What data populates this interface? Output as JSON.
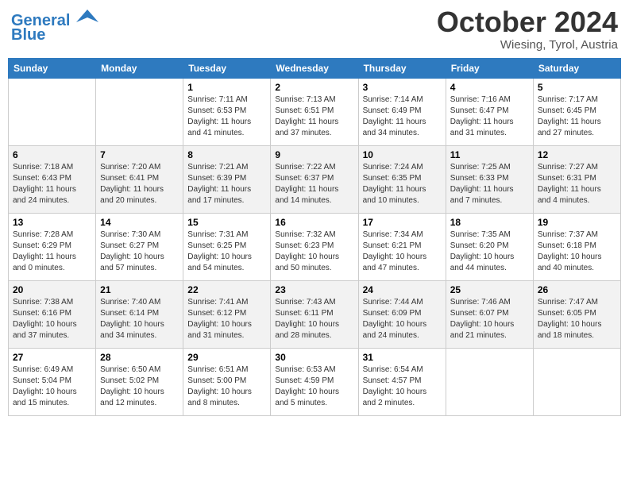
{
  "header": {
    "logo_line1": "General",
    "logo_line2": "Blue",
    "month": "October 2024",
    "location": "Wiesing, Tyrol, Austria"
  },
  "days_of_week": [
    "Sunday",
    "Monday",
    "Tuesday",
    "Wednesday",
    "Thursday",
    "Friday",
    "Saturday"
  ],
  "weeks": [
    [
      {
        "day": "",
        "detail": ""
      },
      {
        "day": "",
        "detail": ""
      },
      {
        "day": "1",
        "detail": "Sunrise: 7:11 AM\nSunset: 6:53 PM\nDaylight: 11 hours and 41 minutes."
      },
      {
        "day": "2",
        "detail": "Sunrise: 7:13 AM\nSunset: 6:51 PM\nDaylight: 11 hours and 37 minutes."
      },
      {
        "day": "3",
        "detail": "Sunrise: 7:14 AM\nSunset: 6:49 PM\nDaylight: 11 hours and 34 minutes."
      },
      {
        "day": "4",
        "detail": "Sunrise: 7:16 AM\nSunset: 6:47 PM\nDaylight: 11 hours and 31 minutes."
      },
      {
        "day": "5",
        "detail": "Sunrise: 7:17 AM\nSunset: 6:45 PM\nDaylight: 11 hours and 27 minutes."
      }
    ],
    [
      {
        "day": "6",
        "detail": "Sunrise: 7:18 AM\nSunset: 6:43 PM\nDaylight: 11 hours and 24 minutes."
      },
      {
        "day": "7",
        "detail": "Sunrise: 7:20 AM\nSunset: 6:41 PM\nDaylight: 11 hours and 20 minutes."
      },
      {
        "day": "8",
        "detail": "Sunrise: 7:21 AM\nSunset: 6:39 PM\nDaylight: 11 hours and 17 minutes."
      },
      {
        "day": "9",
        "detail": "Sunrise: 7:22 AM\nSunset: 6:37 PM\nDaylight: 11 hours and 14 minutes."
      },
      {
        "day": "10",
        "detail": "Sunrise: 7:24 AM\nSunset: 6:35 PM\nDaylight: 11 hours and 10 minutes."
      },
      {
        "day": "11",
        "detail": "Sunrise: 7:25 AM\nSunset: 6:33 PM\nDaylight: 11 hours and 7 minutes."
      },
      {
        "day": "12",
        "detail": "Sunrise: 7:27 AM\nSunset: 6:31 PM\nDaylight: 11 hours and 4 minutes."
      }
    ],
    [
      {
        "day": "13",
        "detail": "Sunrise: 7:28 AM\nSunset: 6:29 PM\nDaylight: 11 hours and 0 minutes."
      },
      {
        "day": "14",
        "detail": "Sunrise: 7:30 AM\nSunset: 6:27 PM\nDaylight: 10 hours and 57 minutes."
      },
      {
        "day": "15",
        "detail": "Sunrise: 7:31 AM\nSunset: 6:25 PM\nDaylight: 10 hours and 54 minutes."
      },
      {
        "day": "16",
        "detail": "Sunrise: 7:32 AM\nSunset: 6:23 PM\nDaylight: 10 hours and 50 minutes."
      },
      {
        "day": "17",
        "detail": "Sunrise: 7:34 AM\nSunset: 6:21 PM\nDaylight: 10 hours and 47 minutes."
      },
      {
        "day": "18",
        "detail": "Sunrise: 7:35 AM\nSunset: 6:20 PM\nDaylight: 10 hours and 44 minutes."
      },
      {
        "day": "19",
        "detail": "Sunrise: 7:37 AM\nSunset: 6:18 PM\nDaylight: 10 hours and 40 minutes."
      }
    ],
    [
      {
        "day": "20",
        "detail": "Sunrise: 7:38 AM\nSunset: 6:16 PM\nDaylight: 10 hours and 37 minutes."
      },
      {
        "day": "21",
        "detail": "Sunrise: 7:40 AM\nSunset: 6:14 PM\nDaylight: 10 hours and 34 minutes."
      },
      {
        "day": "22",
        "detail": "Sunrise: 7:41 AM\nSunset: 6:12 PM\nDaylight: 10 hours and 31 minutes."
      },
      {
        "day": "23",
        "detail": "Sunrise: 7:43 AM\nSunset: 6:11 PM\nDaylight: 10 hours and 28 minutes."
      },
      {
        "day": "24",
        "detail": "Sunrise: 7:44 AM\nSunset: 6:09 PM\nDaylight: 10 hours and 24 minutes."
      },
      {
        "day": "25",
        "detail": "Sunrise: 7:46 AM\nSunset: 6:07 PM\nDaylight: 10 hours and 21 minutes."
      },
      {
        "day": "26",
        "detail": "Sunrise: 7:47 AM\nSunset: 6:05 PM\nDaylight: 10 hours and 18 minutes."
      }
    ],
    [
      {
        "day": "27",
        "detail": "Sunrise: 6:49 AM\nSunset: 5:04 PM\nDaylight: 10 hours and 15 minutes."
      },
      {
        "day": "28",
        "detail": "Sunrise: 6:50 AM\nSunset: 5:02 PM\nDaylight: 10 hours and 12 minutes."
      },
      {
        "day": "29",
        "detail": "Sunrise: 6:51 AM\nSunset: 5:00 PM\nDaylight: 10 hours and 8 minutes."
      },
      {
        "day": "30",
        "detail": "Sunrise: 6:53 AM\nSunset: 4:59 PM\nDaylight: 10 hours and 5 minutes."
      },
      {
        "day": "31",
        "detail": "Sunrise: 6:54 AM\nSunset: 4:57 PM\nDaylight: 10 hours and 2 minutes."
      },
      {
        "day": "",
        "detail": ""
      },
      {
        "day": "",
        "detail": ""
      }
    ]
  ]
}
